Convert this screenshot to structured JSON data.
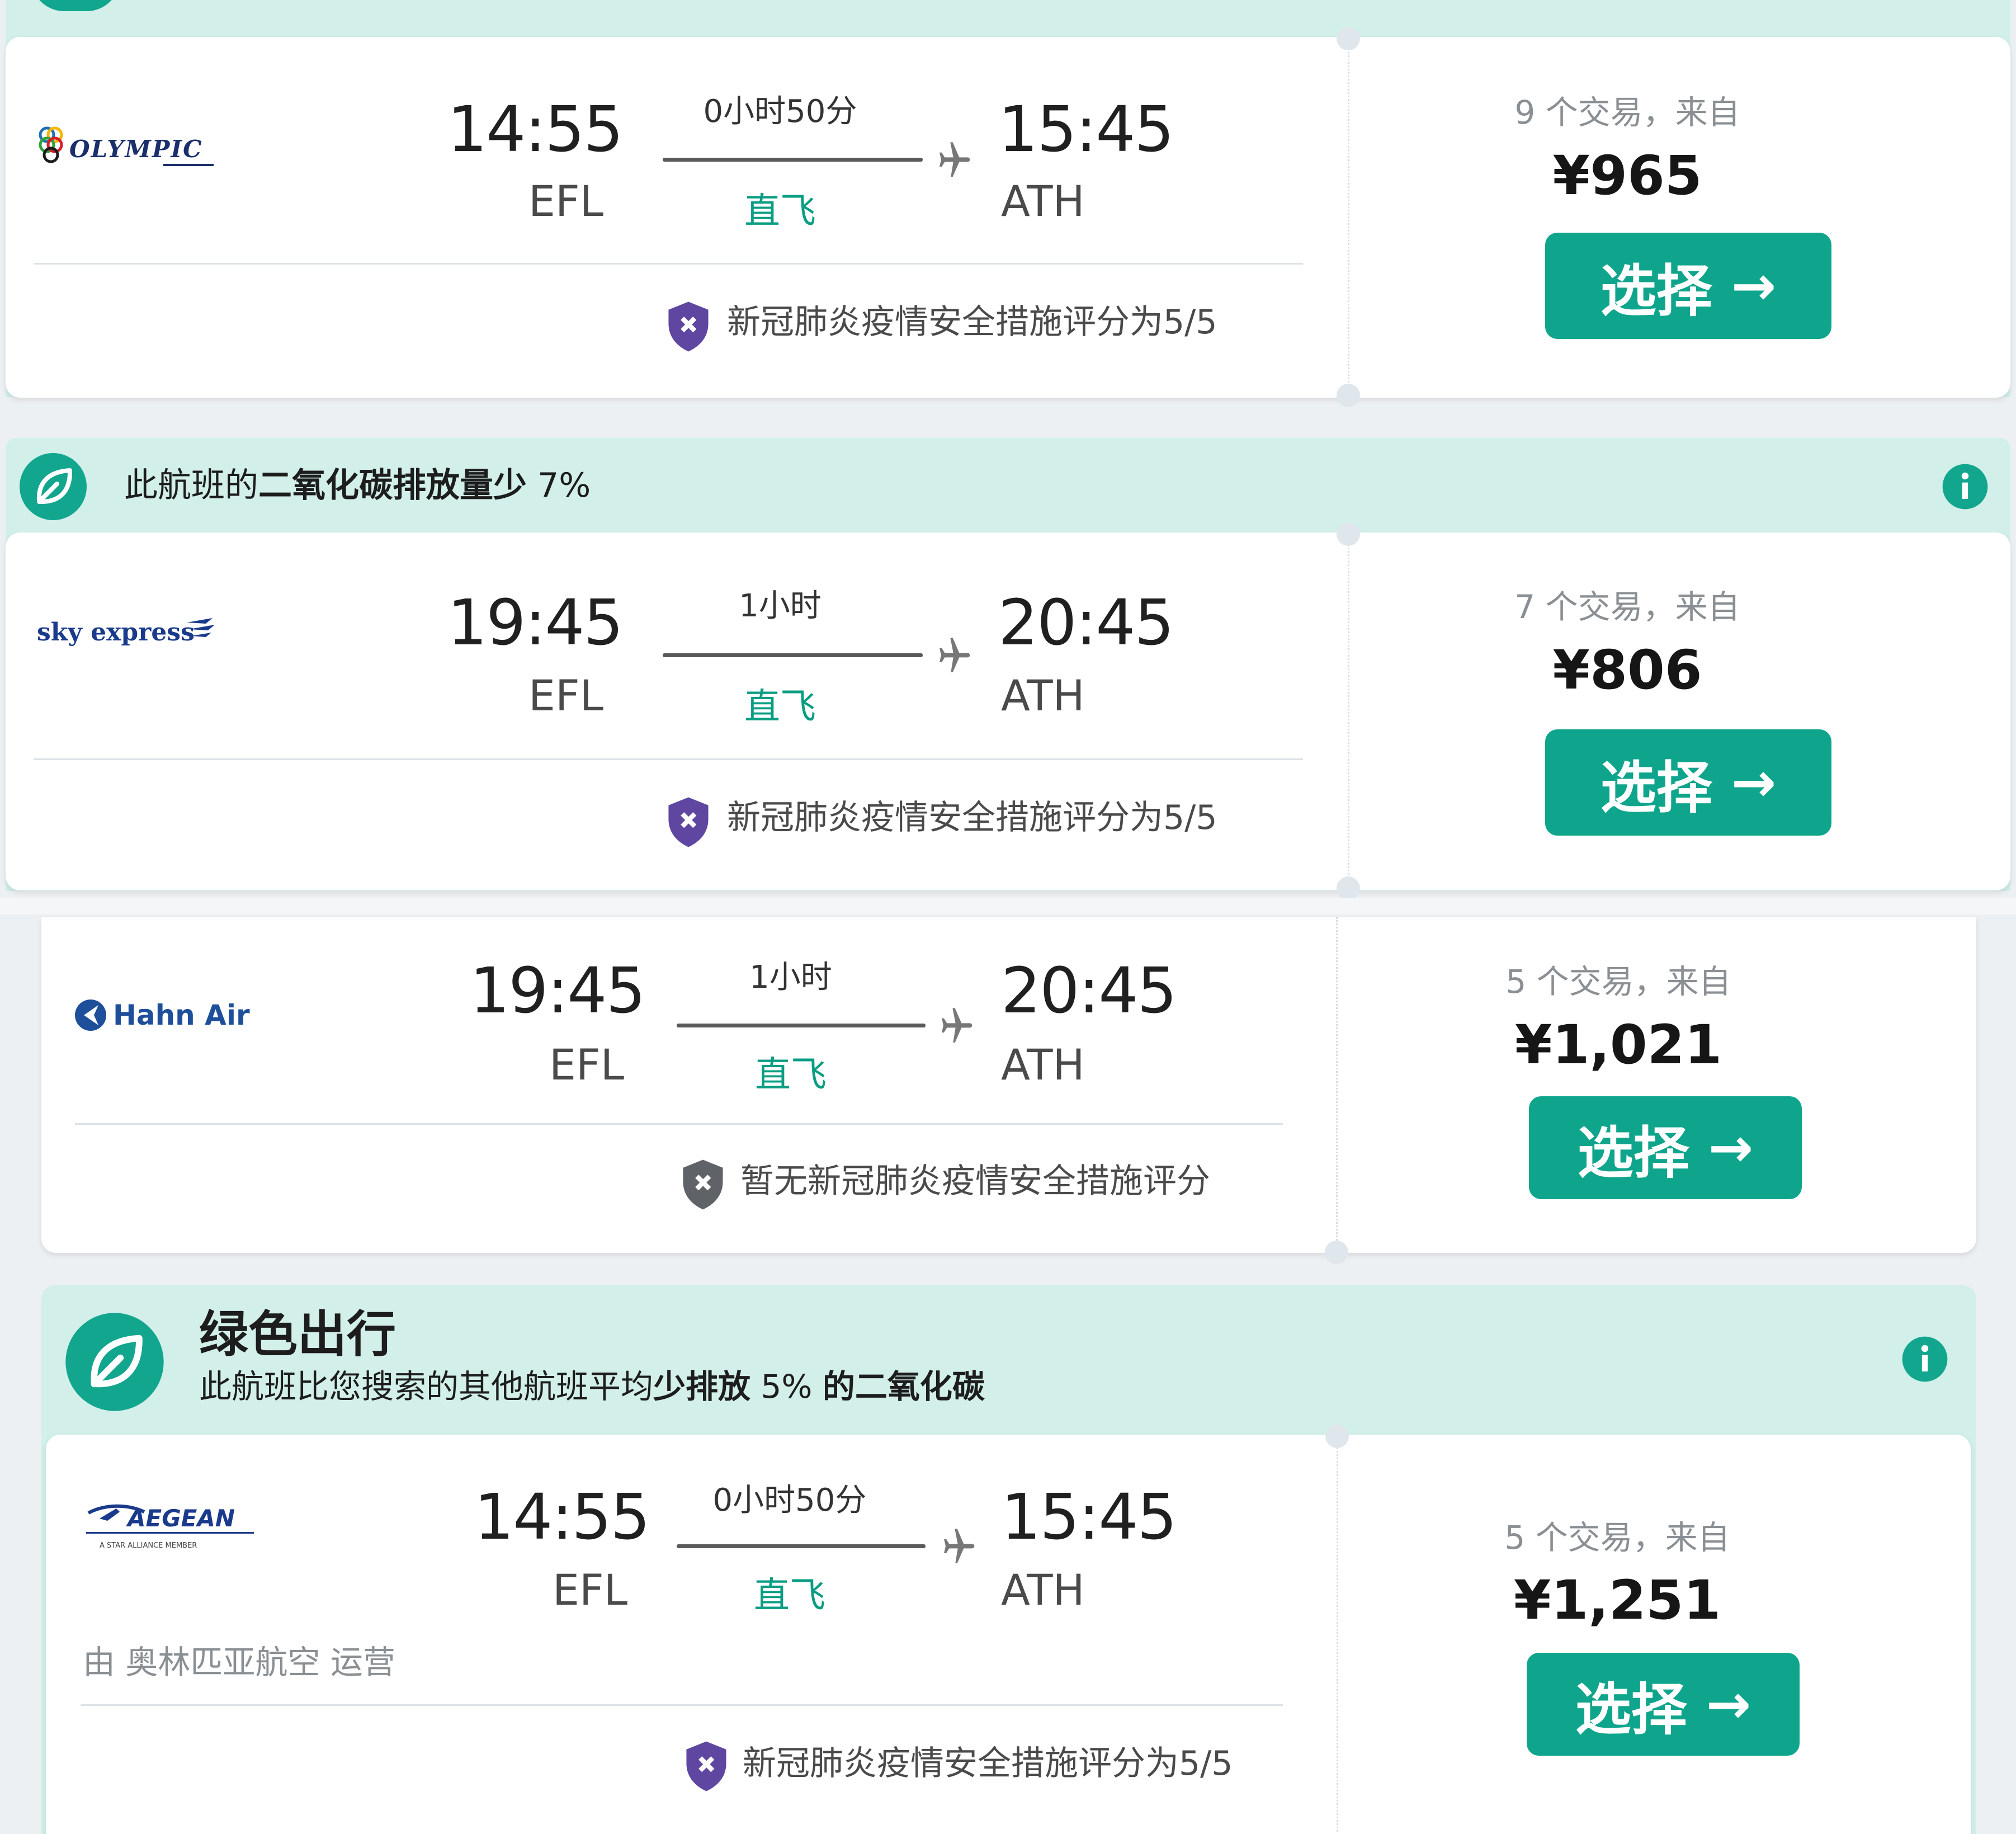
{
  "colors": {
    "accent": "#0fa58c",
    "eco_band": "#d2efe9",
    "stops_text": "#0a9d83",
    "shield_rated": "#5e46a1",
    "shield_unrated": "#5f6368",
    "info_icon": "#12a68e"
  },
  "eco_banners": [
    {
      "text_prefix": "此航班的",
      "text_bold": "二氧化碳排放量少",
      "text_suffix": " 7%",
      "icon": "leaf-icon",
      "info_icon": "info-icon"
    },
    {
      "title": "绿色出行",
      "text_prefix": "此航班比您搜索的其他航班平均",
      "text_bold": "少排放",
      "text_mid": " 5% ",
      "text_bold2": "的二氧化碳",
      "icon": "leaf-icon",
      "info_icon": "info-icon"
    }
  ],
  "flights": [
    {
      "airline_logo_text": "OLYMPIC",
      "depart_time": "14:55",
      "depart_code": "EFL",
      "duration": "0小时50分",
      "stops": "直飞",
      "arrive_time": "15:45",
      "arrive_code": "ATH",
      "safety": "新冠肺炎疫情安全措施评分为5/5",
      "safety_rated": true,
      "deals": "9 个交易，来自",
      "price": "¥965",
      "select_label": "选择",
      "select_arrow": "→"
    },
    {
      "airline_logo_text": "sky express",
      "depart_time": "19:45",
      "depart_code": "EFL",
      "duration": "1小时",
      "stops": "直飞",
      "arrive_time": "20:45",
      "arrive_code": "ATH",
      "safety": "新冠肺炎疫情安全措施评分为5/5",
      "safety_rated": true,
      "deals": "7 个交易，来自",
      "price": "¥806",
      "select_label": "选择",
      "select_arrow": "→"
    },
    {
      "airline_logo_text": "Hahn Air",
      "depart_time": "19:45",
      "depart_code": "EFL",
      "duration": "1小时",
      "stops": "直飞",
      "arrive_time": "20:45",
      "arrive_code": "ATH",
      "safety": "暂无新冠肺炎疫情安全措施评分",
      "safety_rated": false,
      "deals": "5 个交易，来自",
      "price": "¥1,021",
      "select_label": "选择",
      "select_arrow": "→"
    },
    {
      "airline_logo_text": "AEGEAN",
      "airline_logo_subtext": "A STAR ALLIANCE MEMBER",
      "depart_time": "14:55",
      "depart_code": "EFL",
      "duration": "0小时50分",
      "stops": "直飞",
      "arrive_time": "15:45",
      "arrive_code": "ATH",
      "operated_by": "由 奥林匹亚航空 运营",
      "safety": "新冠肺炎疫情安全措施评分为5/5",
      "safety_rated": true,
      "deals": "5 个交易，来自",
      "price": "¥1,251",
      "select_label": "选择",
      "select_arrow": "→"
    }
  ]
}
